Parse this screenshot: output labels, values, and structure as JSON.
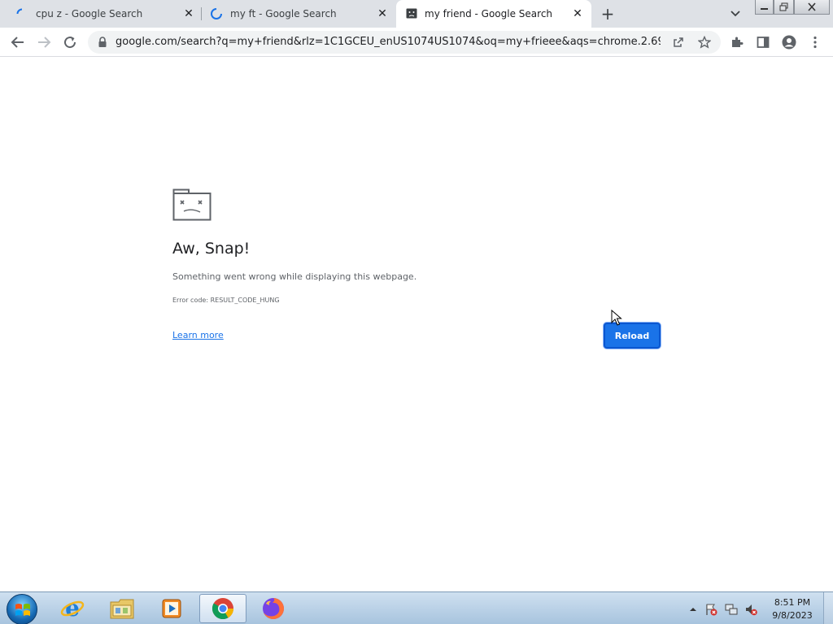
{
  "browser": {
    "tabs": [
      {
        "title": "cpu z - Google Search",
        "state": "loading"
      },
      {
        "title": "my ft - Google Search",
        "state": "loading"
      },
      {
        "title": "my friend - Google Search",
        "state": "active-crashed"
      }
    ],
    "new_tab_label": "+",
    "address_url": "google.com/search?q=my+friend&rlz=1C1GCEU_enUS1074US1074&oq=my+frieee&aqs=chrome.2.69i57j..."
  },
  "error_page": {
    "title": "Aw, Snap!",
    "message": "Something went wrong while displaying this webpage.",
    "error_code": "Error code: RESULT_CODE_HUNG",
    "learn_more": "Learn more",
    "reload_label": "Reload"
  },
  "taskbar": {
    "time": "8:51 PM",
    "date": "9/8/2023",
    "apps": [
      "internet-explorer",
      "windows-explorer",
      "media-player",
      "chrome",
      "firefox"
    ]
  },
  "colors": {
    "accent": "#1a73e8",
    "tabstrip": "#dee1e6"
  }
}
